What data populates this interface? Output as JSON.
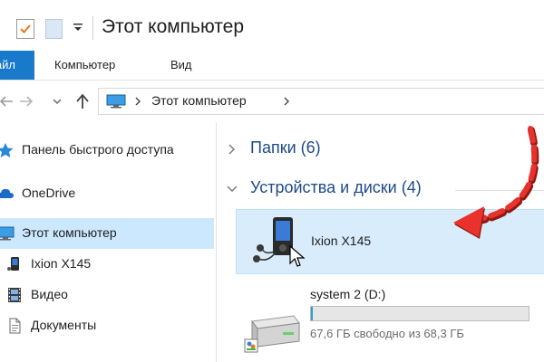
{
  "window": {
    "title": "Этот компьютер"
  },
  "ribbon": {
    "tabs": [
      {
        "label": "Файл"
      },
      {
        "label": "Компьютер"
      },
      {
        "label": "Вид"
      }
    ]
  },
  "address": {
    "path": "Этот компьютер"
  },
  "sidebar": {
    "items": [
      {
        "label": "Панель быстрого доступа",
        "icon": "star-icon"
      },
      {
        "label": "OneDrive",
        "icon": "cloud-icon"
      },
      {
        "label": "Этот компьютер",
        "icon": "computer-icon",
        "selected": true
      },
      {
        "label": "Ixion X145",
        "icon": "media-player-icon"
      },
      {
        "label": "Видео",
        "icon": "film-icon"
      },
      {
        "label": "Документы",
        "icon": "document-icon"
      }
    ]
  },
  "main": {
    "groups": [
      {
        "label": "Папки (6)",
        "expanded": false
      },
      {
        "label": "Устройства и диски (4)",
        "expanded": true
      }
    ],
    "devices": [
      {
        "name": "Ixion X145",
        "icon": "media-player-icon",
        "highlighted": true
      }
    ],
    "drives": [
      {
        "name": "system 2 (D:)",
        "free_text": "67,6 ГБ свободно из 68,3 ГБ",
        "used_fraction": 0.01,
        "icon": "hard-drive-icon"
      }
    ]
  },
  "colors": {
    "accent": "#1979ca",
    "selection": "#cce8ff",
    "annotation_arrow": "#e8322b",
    "drive_bar": "#26a0da"
  }
}
